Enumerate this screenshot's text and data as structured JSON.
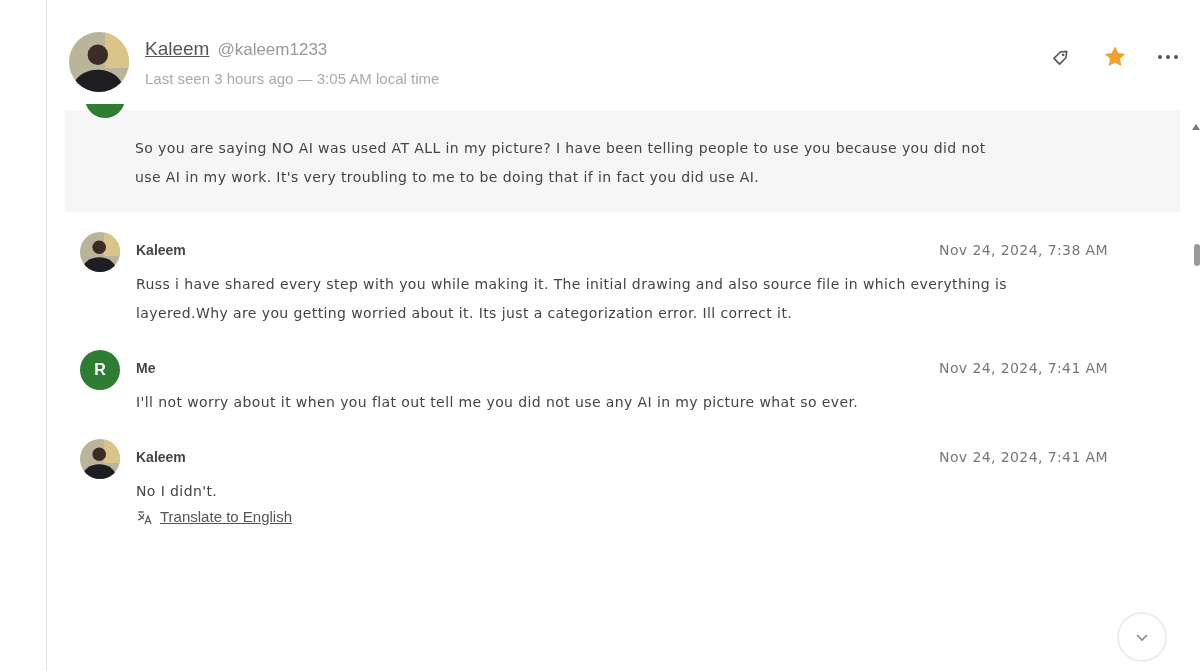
{
  "contact": {
    "name": "Kaleem",
    "handle": "@kaleem1233",
    "status": "Last seen 3 hours ago — 3:05 AM local time",
    "starred": true
  },
  "messages": [
    {
      "partial": true,
      "highlighted": true,
      "avatar": {
        "kind": "letter",
        "color": "#2e7d32"
      },
      "text": "So you are saying NO AI was used AT ALL in my picture? I have been telling people to use you because you did not use AI in my work. It's very troubling to me to be doing that if in fact you did use AI."
    },
    {
      "partial": false,
      "highlighted": false,
      "avatar": {
        "kind": "photo"
      },
      "sender": "Kaleem",
      "time": "Nov 24, 2024, 7:38 AM",
      "text": "Russ i have shared every step with you while making it. The initial drawing and also source file in which everything is layered.Why are you getting worried about it. Its just a categorization error. Ill correct it."
    },
    {
      "partial": false,
      "highlighted": false,
      "avatar": {
        "kind": "letter",
        "letter": "R",
        "color": "#2e7d32"
      },
      "sender": "Me",
      "time": "Nov 24, 2024, 7:41 AM",
      "text": "I'll not worry about it when you flat out tell me you did not use any AI in my picture what so ever."
    },
    {
      "partial": false,
      "highlighted": false,
      "avatar": {
        "kind": "photo"
      },
      "sender": "Kaleem",
      "time": "Nov 24, 2024, 7:41 AM",
      "text": "No I didn't.",
      "translate": "Translate to English"
    }
  ]
}
